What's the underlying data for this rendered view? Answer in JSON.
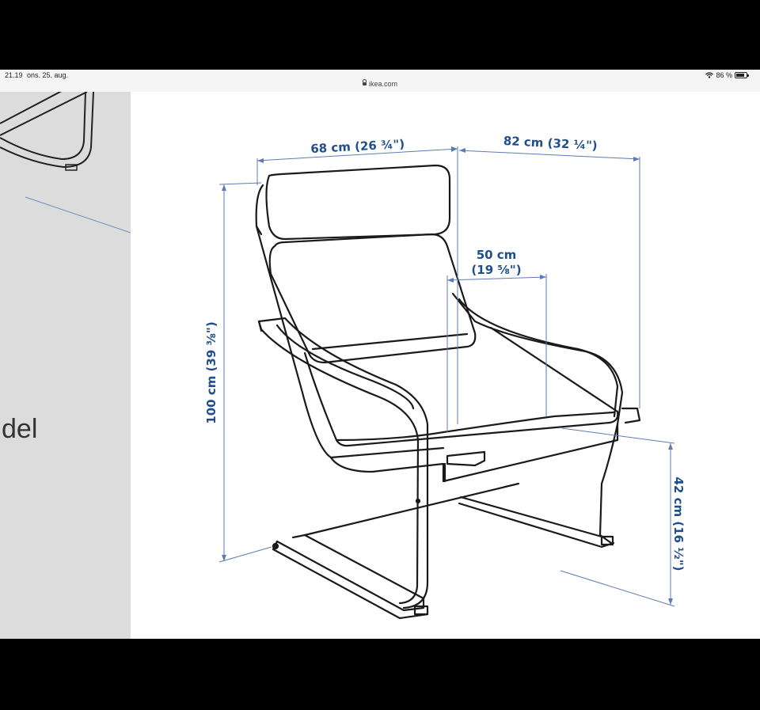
{
  "status_bar": {
    "time": "21.19",
    "date": "ons. 25. aug.",
    "url": "ikea.com",
    "battery": "86 %",
    "battery_level": 0.86
  },
  "left_panel": {
    "partial_text": "del"
  },
  "dimensions": {
    "width": "68 cm (26 ¾\")",
    "depth": "82 cm (32 ¼\")",
    "seat_depth_cm": "50 cm",
    "seat_depth_in": "(19 ⅝\")",
    "height": "100 cm (39 ⅜\")",
    "seat_height": "42 cm (16 ½\")"
  },
  "colors": {
    "dimension_blue": "#1f4e8c",
    "panel_gray": "#dcdcdc"
  }
}
